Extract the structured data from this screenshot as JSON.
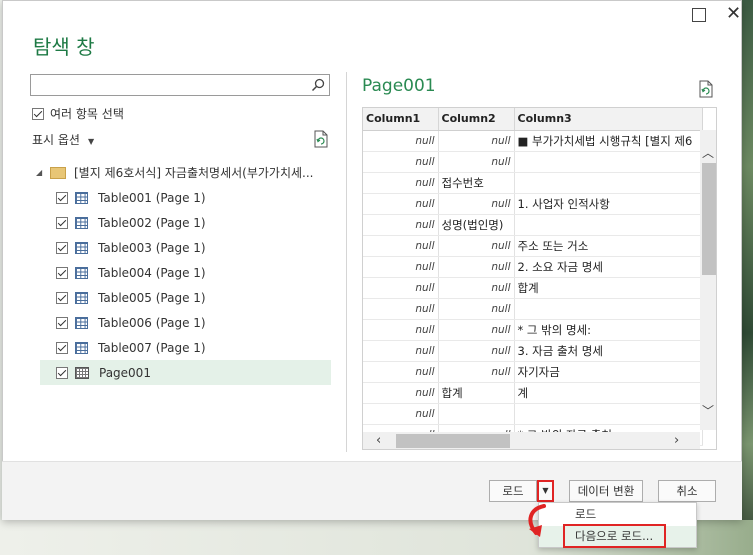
{
  "dialog": {
    "title": "탐색 창",
    "search": {
      "placeholder": ""
    },
    "multi_select_label": "여러 항목 선택",
    "display_options_label": "표시 옵션",
    "tree": {
      "folder_label": "[별지 제6호서식] 자금출처명세서(부가가치세...",
      "items": [
        {
          "label": "Table001 (Page 1)",
          "icon": "table-icon",
          "checked": true
        },
        {
          "label": "Table002 (Page 1)",
          "icon": "table-icon",
          "checked": true
        },
        {
          "label": "Table003 (Page 1)",
          "icon": "table-icon",
          "checked": true
        },
        {
          "label": "Table004 (Page 1)",
          "icon": "table-icon",
          "checked": true
        },
        {
          "label": "Table005 (Page 1)",
          "icon": "table-icon",
          "checked": true
        },
        {
          "label": "Table006 (Page 1)",
          "icon": "table-icon",
          "checked": true
        },
        {
          "label": "Table007 (Page 1)",
          "icon": "table-icon",
          "checked": true
        },
        {
          "label": "Page001",
          "icon": "page-icon",
          "checked": true,
          "selected": true
        }
      ]
    },
    "preview": {
      "title": "Page001",
      "columns": [
        "Column1",
        "Column2",
        "Column3"
      ],
      "rows": [
        [
          "null",
          "null",
          "■ 부가가치세법 시행규칙 [별지 제6"
        ],
        [
          "null",
          "null",
          ""
        ],
        [
          "null",
          "접수번호",
          ""
        ],
        [
          "null",
          "null",
          "1. 사업자 인적사항"
        ],
        [
          "null",
          "성명(법인명)",
          ""
        ],
        [
          "null",
          "null",
          "주소 또는 거소"
        ],
        [
          "null",
          "null",
          "2. 소요 자금 명세"
        ],
        [
          "null",
          "null",
          "합계"
        ],
        [
          "null",
          "null",
          ""
        ],
        [
          "null",
          "null",
          "* 그 밖의 명세:"
        ],
        [
          "null",
          "null",
          "3. 자금 출처 명세"
        ],
        [
          "null",
          "null",
          "자기자금"
        ],
        [
          "null",
          "합계",
          "계"
        ],
        [
          "null",
          "",
          ""
        ],
        [
          "null",
          "null",
          "* 그 밖의 자금 출처:"
        ]
      ]
    },
    "footer": {
      "load_label": "로드",
      "transform_label": "데이터 변환",
      "cancel_label": "취소"
    },
    "load_menu": {
      "load_label": "로드",
      "load_to_label": "다음으로 로드..."
    }
  }
}
